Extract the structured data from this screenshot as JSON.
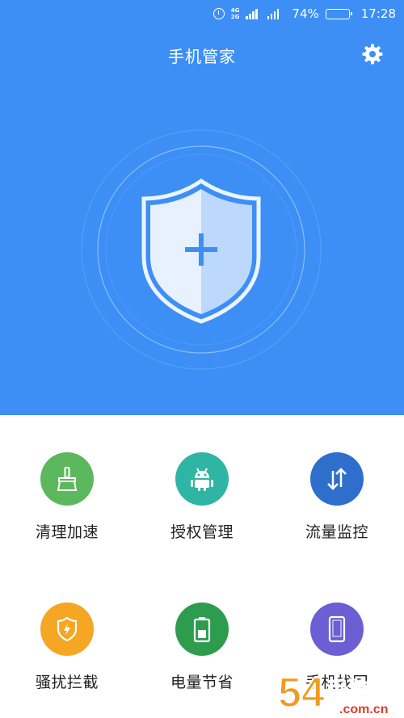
{
  "status_bar": {
    "network_top": "4G",
    "network_bottom": "2G",
    "battery": "74%",
    "battery_level": 0.74,
    "time": "17:28"
  },
  "header": {
    "title": "手机管家"
  },
  "colors": {
    "hero_bg": "#3d8ff6",
    "clean": "#5cb85c",
    "permission": "#2fb5a3",
    "traffic": "#2f6fcc",
    "harass": "#f5a623",
    "battery": "#2e9c4e",
    "find": "#6b5fd3"
  },
  "features": [
    {
      "label": "清理加速",
      "icon": "broom-icon"
    },
    {
      "label": "授权管理",
      "icon": "android-icon"
    },
    {
      "label": "流量监控",
      "icon": "traffic-arrows-icon"
    },
    {
      "label": "骚扰拦截",
      "icon": "shield-bolt-icon"
    },
    {
      "label": "电量节省",
      "icon": "battery-icon"
    },
    {
      "label": "手机找回",
      "icon": "phone-icon"
    }
  ],
  "watermark": {
    "text": "54手游网",
    "sub": ".com.cn"
  }
}
